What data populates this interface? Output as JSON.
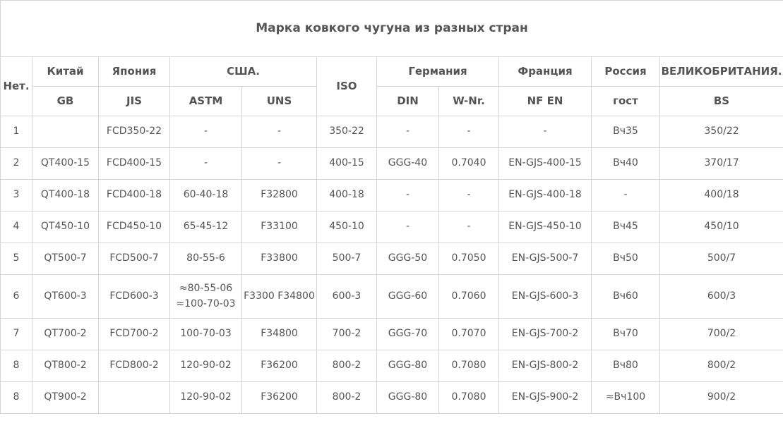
{
  "title": "Марка ковкого чугуна из разных стран",
  "headers": {
    "no": "Нет.",
    "china": "Китай",
    "japan": "Япония",
    "usa": "США.",
    "iso": "ISO",
    "germany": "Германия",
    "france": "Франция",
    "russia": "Россия",
    "uk": "ВЕЛИКОБРИТАНИЯ.",
    "gb": "GB",
    "jis": "JIS",
    "astm": "ASTM",
    "uns": "UNS",
    "din": "DIN",
    "wnr": "W-Nr.",
    "nfen": "NF EN",
    "gost": "гост",
    "bs": "BS"
  },
  "rows": [
    {
      "no": "1",
      "gb": "",
      "jis": "FCD350-22",
      "astm": "-",
      "astm2": "",
      "uns": "-",
      "iso": "350-22",
      "din": "-",
      "wnr": "-",
      "nfen": "-",
      "gost": "Вч35",
      "bs": "350/22"
    },
    {
      "no": "2",
      "gb": "QT400-15",
      "jis": "FCD400-15",
      "astm": "-",
      "astm2": "",
      "uns": "-",
      "iso": "400-15",
      "din": "GGG-40",
      "wnr": "0.7040",
      "nfen": "EN-GJS-400-15",
      "gost": "Вч40",
      "bs": "370/17"
    },
    {
      "no": "3",
      "gb": "QT400-18",
      "jis": "FCD400-18",
      "astm": "60-40-18",
      "astm2": "",
      "uns": "F32800",
      "iso": "400-18",
      "din": "-",
      "wnr": "-",
      "nfen": "EN-GJS-400-18",
      "gost": "-",
      "bs": "400/18"
    },
    {
      "no": "4",
      "gb": "QT450-10",
      "jis": "FCD450-10",
      "astm": "65-45-12",
      "astm2": "",
      "uns": "F33100",
      "iso": "450-10",
      "din": "-",
      "wnr": "-",
      "nfen": "EN-GJS-450-10",
      "gost": "Вч45",
      "bs": "450/10"
    },
    {
      "no": "5",
      "gb": "QT500-7",
      "jis": "FCD500-7",
      "astm": "80-55-6",
      "astm2": "",
      "uns": "F33800",
      "iso": "500-7",
      "din": "GGG-50",
      "wnr": "0.7050",
      "nfen": "EN-GJS-500-7",
      "gost": "Вч50",
      "bs": "500/7"
    },
    {
      "no": "6",
      "gb": "QT600-3",
      "jis": "FCD600-3",
      "astm": "≈80-55-06",
      "astm2": "≈100-70-03",
      "uns": "F3300 F34800",
      "iso": "600-3",
      "din": "GGG-60",
      "wnr": "0.7060",
      "nfen": "EN-GJS-600-3",
      "gost": "Вч60",
      "bs": "600/3"
    },
    {
      "no": "7",
      "gb": "QT700-2",
      "jis": "FCD700-2",
      "astm": "100-70-03",
      "astm2": "",
      "uns": "F34800",
      "iso": "700-2",
      "din": "GGG-70",
      "wnr": "0.7070",
      "nfen": "EN-GJS-700-2",
      "gost": "Вч70",
      "bs": "700/2"
    },
    {
      "no": "8",
      "gb": "QT800-2",
      "jis": "FCD800-2",
      "astm": "120-90-02",
      "astm2": "",
      "uns": "F36200",
      "iso": "800-2",
      "din": "GGG-80",
      "wnr": "0.7080",
      "nfen": "EN-GJS-800-2",
      "gost": "Вч80",
      "bs": "800/2"
    },
    {
      "no": "8",
      "gb": "QT900-2",
      "jis": "",
      "astm": "120-90-02",
      "astm2": "",
      "uns": "F36200",
      "iso": "800-2",
      "din": "GGG-80",
      "wnr": "0.7080",
      "nfen": "EN-GJS-900-2",
      "gost": "≈Вч100",
      "bs": "900/2"
    }
  ]
}
